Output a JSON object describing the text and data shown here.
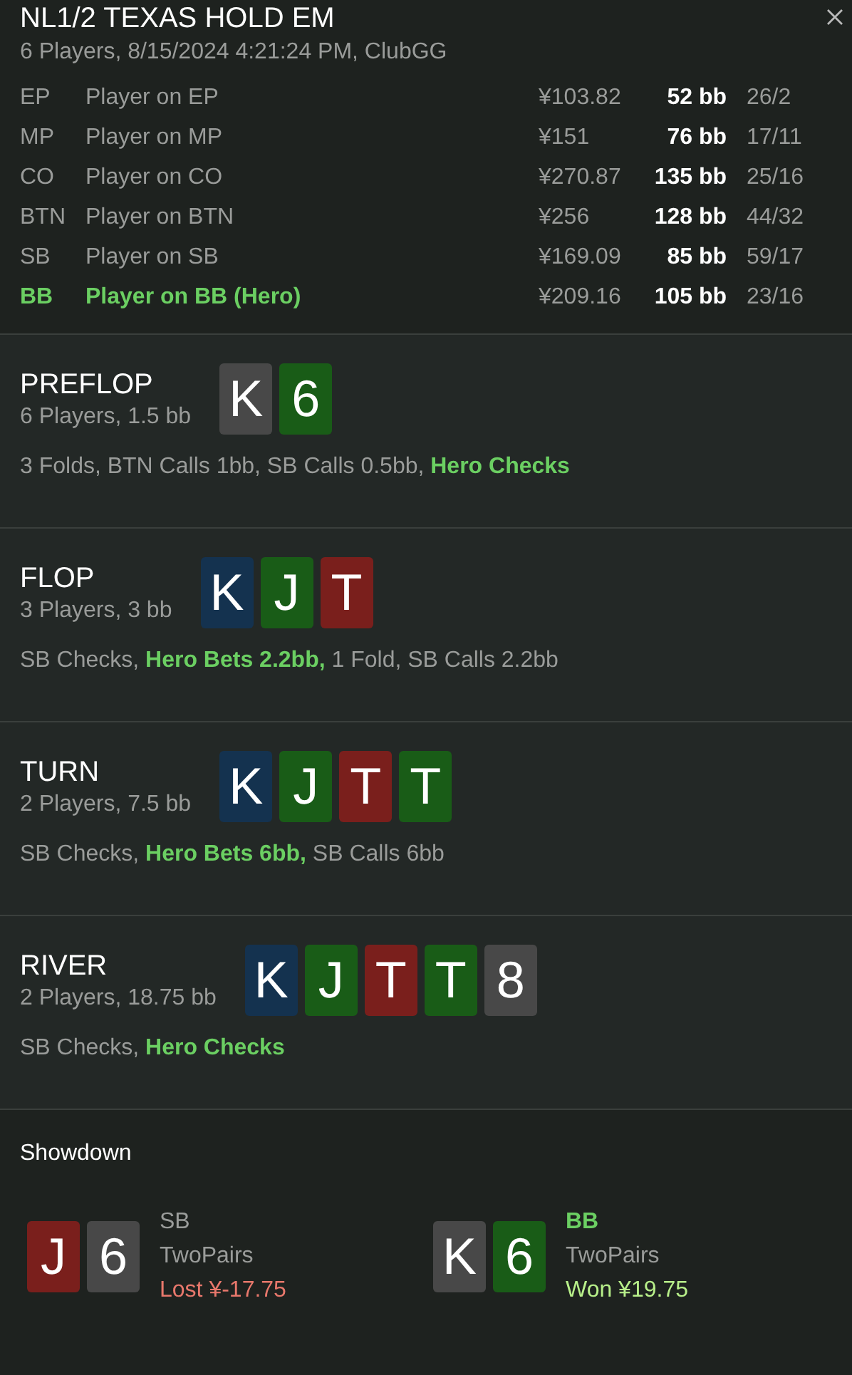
{
  "header": {
    "title": "NL1/2 TEXAS HOLD EM",
    "subtitle": "6 Players, 8/15/2024 4:21:24 PM, ClubGG"
  },
  "players": [
    {
      "position": "EP",
      "name": "Player on EP",
      "stack": "¥103.82",
      "stack_bb": "52 bb",
      "stats": "26/2",
      "hero": false
    },
    {
      "position": "MP",
      "name": "Player on MP",
      "stack": "¥151",
      "stack_bb": "76 bb",
      "stats": "17/11",
      "hero": false
    },
    {
      "position": "CO",
      "name": "Player on CO",
      "stack": "¥270.87",
      "stack_bb": "135 bb",
      "stats": "25/16",
      "hero": false
    },
    {
      "position": "BTN",
      "name": "Player on BTN",
      "stack": "¥256",
      "stack_bb": "128 bb",
      "stats": "44/32",
      "hero": false
    },
    {
      "position": "SB",
      "name": "Player on SB",
      "stack": "¥169.09",
      "stack_bb": "85 bb",
      "stats": "59/17",
      "hero": false
    },
    {
      "position": "BB",
      "name": "Player on BB (Hero)",
      "stack": "¥209.16",
      "stack_bb": "105 bb",
      "stats": "23/16",
      "hero": true
    }
  ],
  "streets": [
    {
      "name": "PREFLOP",
      "info": "6 Players, 1.5 bb",
      "cards": [
        {
          "rank": "K",
          "color": "#484848"
        },
        {
          "rank": "6",
          "color": "#195c17"
        }
      ],
      "actions": "3 Folds, BTN Calls 1bb, SB Calls 0.5bb, **Hero Checks**"
    },
    {
      "name": "FLOP",
      "info": "3 Players, 3 bb",
      "cards": [
        {
          "rank": "K",
          "color": "#14324f"
        },
        {
          "rank": "J",
          "color": "#195c17"
        },
        {
          "rank": "T",
          "color": "#7a1f1c"
        }
      ],
      "actions": "SB Checks, **Hero Bets 2.2bb,** 1 Fold, SB Calls 2.2bb"
    },
    {
      "name": "TURN",
      "info": "2 Players, 7.5 bb",
      "cards": [
        {
          "rank": "K",
          "color": "#14324f"
        },
        {
          "rank": "J",
          "color": "#195c17"
        },
        {
          "rank": "T",
          "color": "#7a1f1c"
        },
        {
          "rank": "T",
          "color": "#195c17"
        }
      ],
      "actions": "SB Checks, **Hero Bets 6bb,** SB Calls 6bb"
    },
    {
      "name": "RIVER",
      "info": "2 Players, 18.75 bb",
      "cards": [
        {
          "rank": "K",
          "color": "#14324f"
        },
        {
          "rank": "J",
          "color": "#195c17"
        },
        {
          "rank": "T",
          "color": "#7a1f1c"
        },
        {
          "rank": "T",
          "color": "#195c17"
        },
        {
          "rank": "8",
          "color": "#484848"
        }
      ],
      "actions": "SB Checks, **Hero Checks**"
    }
  ],
  "showdown": {
    "title": "Showdown",
    "players": [
      {
        "cards": [
          {
            "rank": "J",
            "color": "#7a1f1c"
          },
          {
            "rank": "6",
            "color": "#484848"
          }
        ],
        "position": "SB",
        "hand": "TwoPairs",
        "result": "Lost ¥-17.75",
        "kind": "lost",
        "hero": false
      },
      {
        "cards": [
          {
            "rank": "K",
            "color": "#484848"
          },
          {
            "rank": "6",
            "color": "#195c17"
          }
        ],
        "position": "BB",
        "hand": "TwoPairs",
        "result": "Won ¥19.75",
        "kind": "won",
        "hero": true
      }
    ]
  }
}
